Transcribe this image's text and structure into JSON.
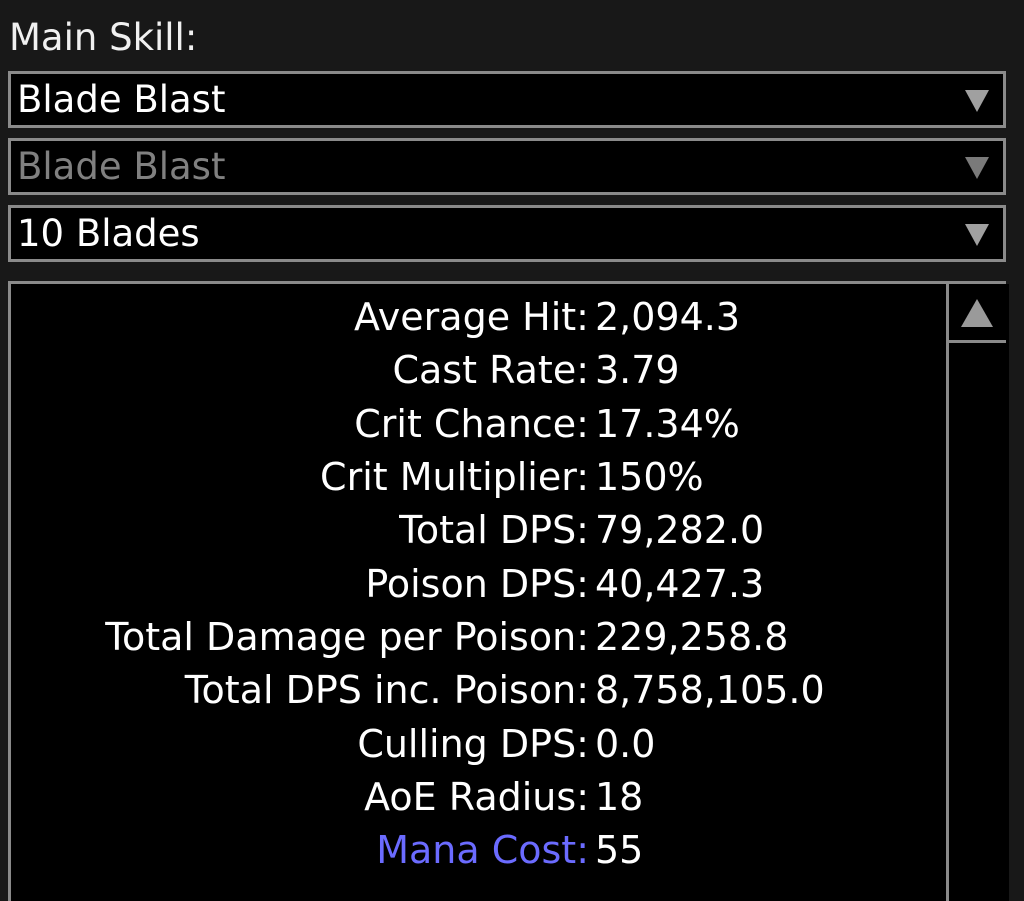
{
  "main_skill": {
    "label": "Main Skill:",
    "dropdowns": [
      {
        "value": "Blade Blast",
        "disabled": false
      },
      {
        "value": "Blade Blast",
        "disabled": true
      },
      {
        "value": "10 Blades",
        "disabled": false
      }
    ]
  },
  "stats": [
    {
      "label": "Average Hit:",
      "value": "2,094.3"
    },
    {
      "label": "Cast Rate:",
      "value": "3.79"
    },
    {
      "label": "Crit Chance:",
      "value": "17.34%"
    },
    {
      "label": "Crit Multiplier:",
      "value": "150%"
    },
    {
      "label": "Total DPS:",
      "value": "79,282.0"
    },
    {
      "label": "Poison DPS:",
      "value": "40,427.3"
    },
    {
      "label": "Total Damage per Poison:",
      "value": "229,258.8"
    },
    {
      "label": "Total DPS inc. Poison:",
      "value": "8,758,105.0"
    },
    {
      "label": "Culling DPS:",
      "value": "0.0"
    },
    {
      "label": "AoE Radius:",
      "value": "18"
    },
    {
      "label": "Mana Cost:",
      "value": "55"
    }
  ],
  "colors": {
    "mana_label": "#6b6bff",
    "border": "#8a8a8a",
    "disabled_text": "#808080"
  }
}
